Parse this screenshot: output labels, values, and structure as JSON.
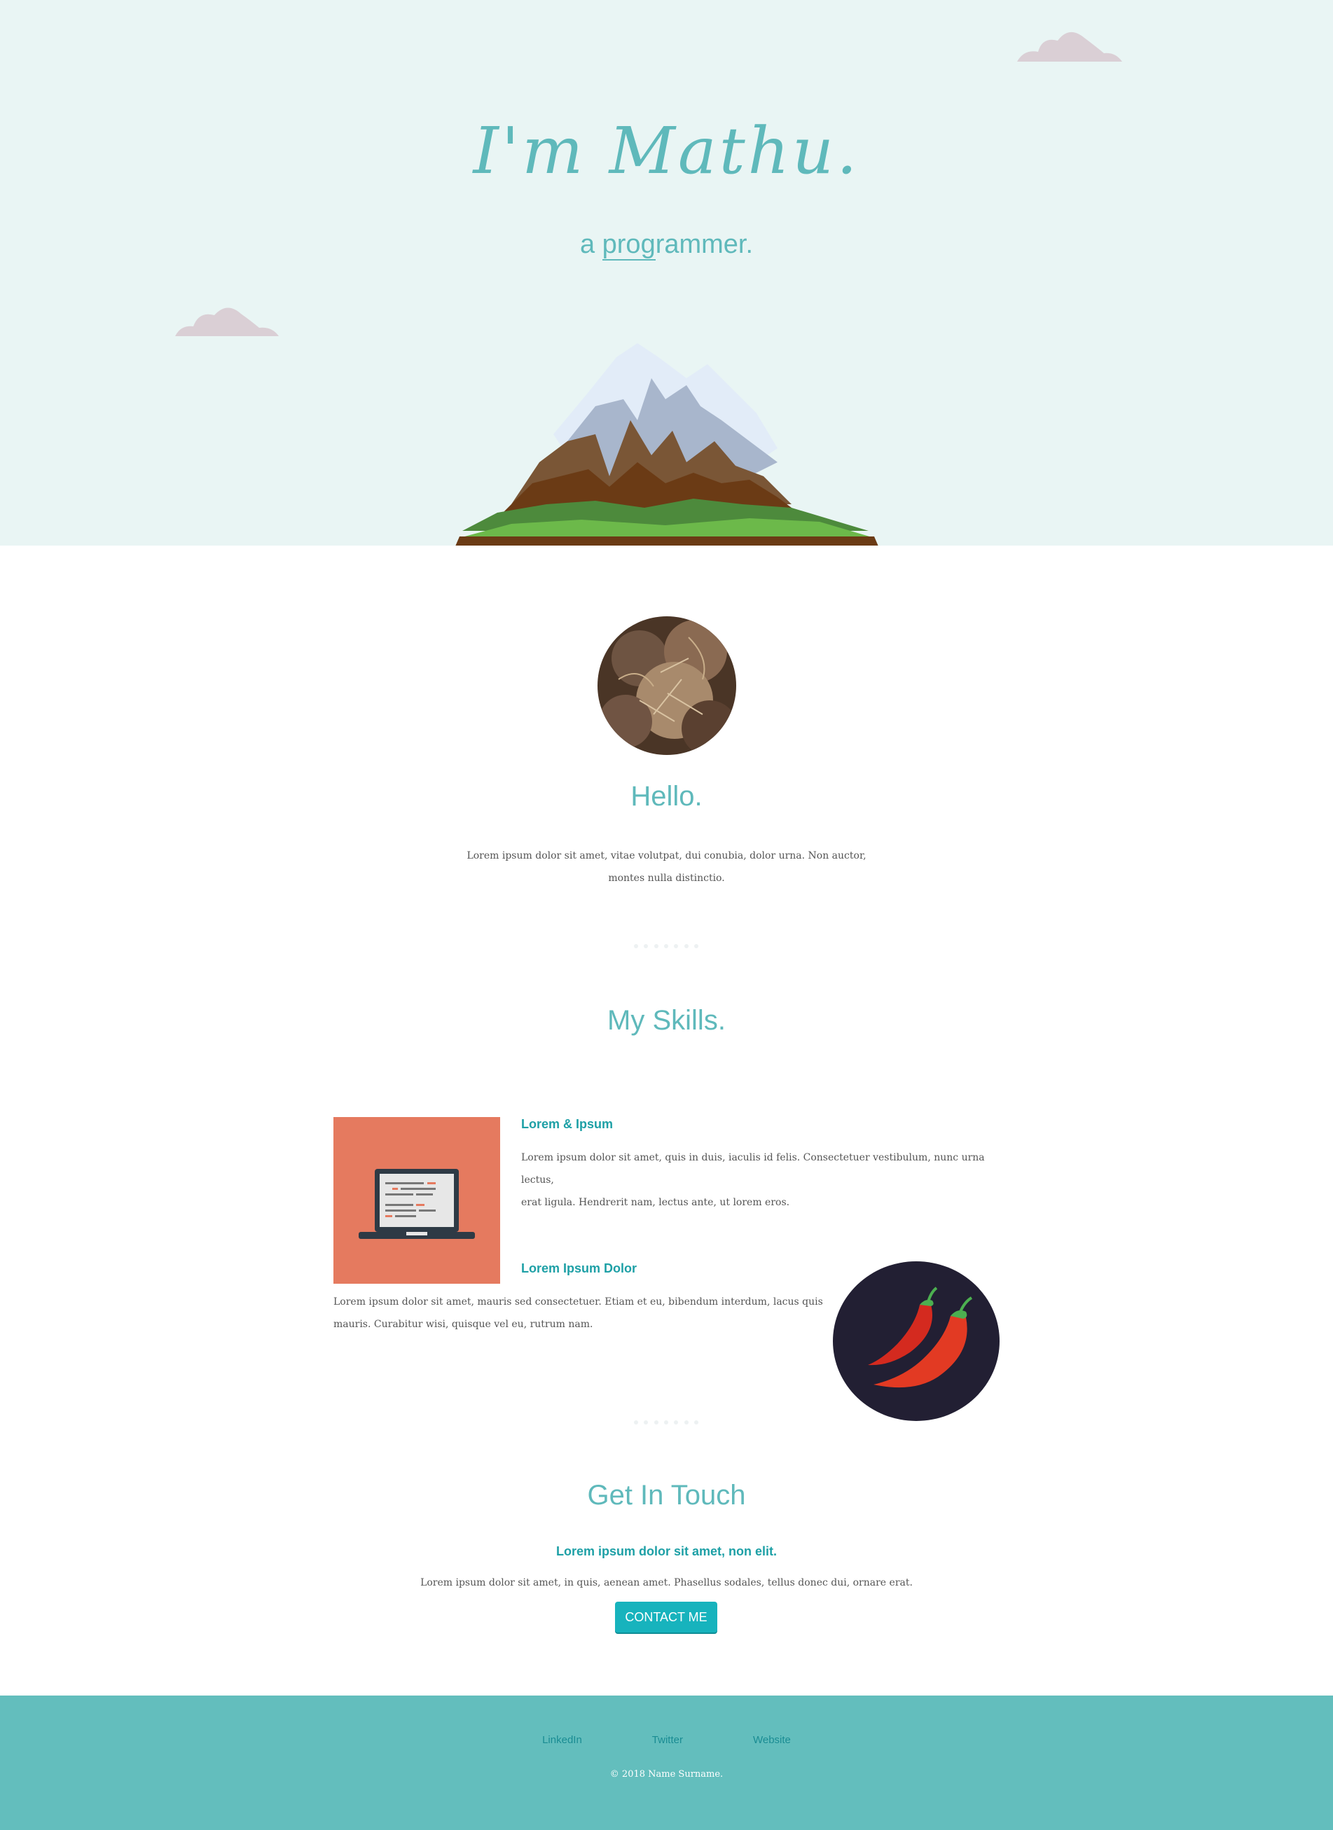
{
  "hero": {
    "title": "I'm Mathu.",
    "subtitle_prefix": "a ",
    "subtitle_typed": "prog",
    "subtitle_rest": "rammer."
  },
  "about": {
    "heading": "Hello.",
    "text_line1": "Lorem ipsum dolor sit amet, vitae volutpat, dui conubia, dolor urna. Non auctor,",
    "text_line2": "montes nulla distinctio."
  },
  "skills": {
    "heading": "My Skills.",
    "items": [
      {
        "title": "Lorem & Ipsum",
        "text_line1": "Lorem ipsum dolor sit amet, quis in duis, iaculis id felis. Consectetuer vestibulum, nunc urna lectus,",
        "text_line2": "erat ligula. Hendrerit nam, lectus ante, ut lorem eros.",
        "icon": "laptop-icon"
      },
      {
        "title": "Lorem Ipsum Dolor",
        "text_line1": "Lorem ipsum dolor sit amet, mauris sed consectetuer. Etiam et eu, bibendum interdum, lacus quis",
        "text_line2": "mauris. Curabitur wisi, quisque vel eu, rutrum nam.",
        "icon": "chili-peppers-icon"
      }
    ]
  },
  "contact": {
    "heading": "Get In Touch",
    "lead": "Lorem ipsum dolor sit amet, non elit.",
    "text": "Lorem ipsum dolor sit amet, in quis, aenean amet. Phasellus sodales, tellus donec dui, ornare erat.",
    "button_label": "CONTACT ME"
  },
  "footer": {
    "links": [
      "LinkedIn",
      "Twitter",
      "Website"
    ],
    "copyright": "© 2018 Name Surname."
  },
  "colors": {
    "accent": "#5fb9bb",
    "hero_bg": "#e9f5f4",
    "footer_bg": "#63bebd",
    "button": "#17b3bd",
    "skill_tile": "#e57a5f",
    "skill_circle": "#221f33"
  }
}
